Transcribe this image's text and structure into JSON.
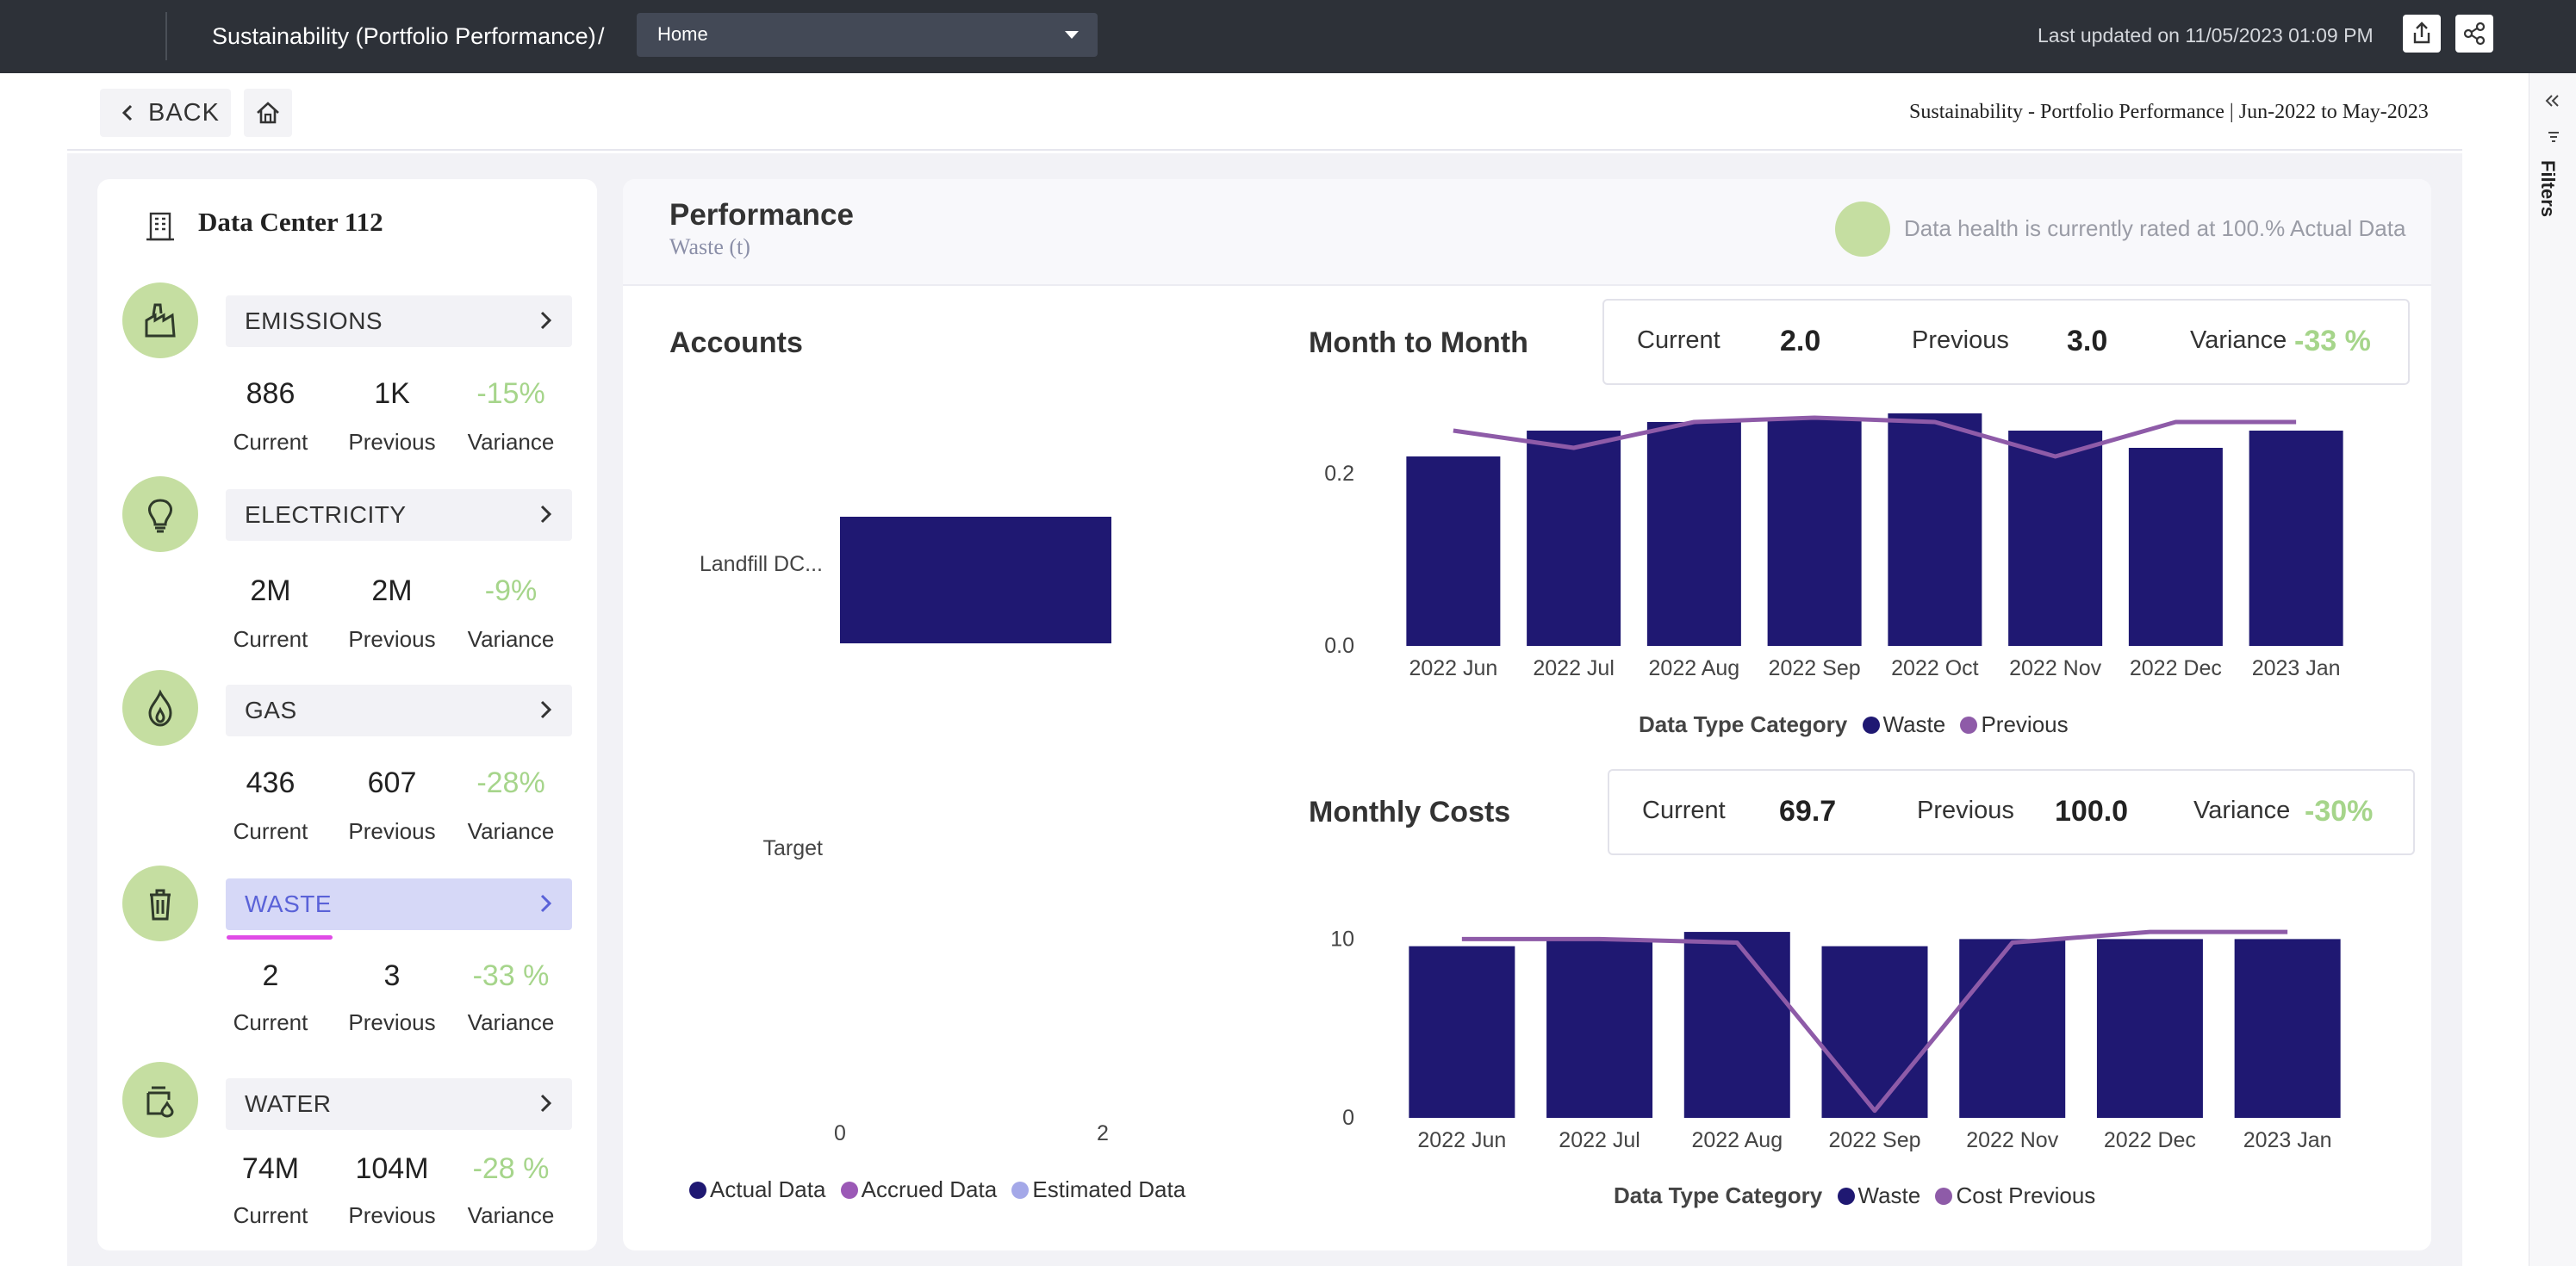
{
  "header": {
    "breadcrumb": "Sustainability (Portfolio Performance)",
    "separator": "/",
    "dropdown_value": "Home",
    "last_updated": "Last updated on 11/05/2023 01:09 PM"
  },
  "subheader": {
    "back_label": "BACK",
    "page_title": "Sustainability - Portfolio Performance | Jun-2022 to May-2023"
  },
  "filters_label": "Filters",
  "sidebar": {
    "site_name": "Data Center 112",
    "categories": [
      {
        "name": "EMISSIONS",
        "icon": "factory-icon",
        "current": "886",
        "previous": "1K",
        "variance": "-15%",
        "current_label": "Current",
        "previous_label": "Previous",
        "variance_label": "Variance"
      },
      {
        "name": "ELECTRICITY",
        "icon": "lightbulb-icon",
        "current": "2M",
        "previous": "2M",
        "variance": "-9%",
        "current_label": "Current",
        "previous_label": "Previous",
        "variance_label": "Variance"
      },
      {
        "name": "GAS",
        "icon": "gas-flame-icon",
        "current": "436",
        "previous": "607",
        "variance": "-28%",
        "current_label": "Current",
        "previous_label": "Previous",
        "variance_label": "Variance"
      },
      {
        "name": "WASTE",
        "icon": "trash-bin-icon",
        "current": "2",
        "previous": "3",
        "variance": "-33 %",
        "current_label": "Current",
        "previous_label": "Previous",
        "variance_label": "Variance",
        "active": true
      },
      {
        "name": "WATER",
        "icon": "water-icon",
        "current": "74M",
        "previous": "104M",
        "variance": "-28 %",
        "current_label": "Current",
        "previous_label": "Previous",
        "variance_label": "Variance"
      }
    ]
  },
  "performance": {
    "title": "Performance",
    "subtitle": "Waste (t)",
    "health_text": "Data health is currently rated at 100.% Actual Data",
    "accounts": {
      "title": "Accounts",
      "legend": [
        "Actual Data",
        "Accrued Data",
        "Estimated Data"
      ]
    },
    "month_to_month": {
      "title": "Month to Month",
      "current_label": "Current",
      "current": "2.0",
      "previous_label": "Previous",
      "previous": "3.0",
      "variance_label": "Variance",
      "variance": "-33 %",
      "legend_title": "Data Type Category",
      "legend": [
        "Waste",
        "Previous"
      ]
    },
    "monthly_costs": {
      "title": "Monthly Costs",
      "current_label": "Current",
      "current": "69.7",
      "previous_label": "Previous",
      "previous": "100.0",
      "variance_label": "Variance",
      "variance": "-30%",
      "legend_title": "Data Type Category",
      "legend": [
        "Waste",
        "Cost Previous"
      ]
    }
  },
  "colors": {
    "bar": "#1f1872",
    "line": "#8e5ba8",
    "accrued": "#9b59b6",
    "estimated": "#a4a8e8",
    "positive": "#a6d58b"
  },
  "chart_data": [
    {
      "type": "bar",
      "orientation": "horizontal",
      "categories": [
        "Landfill DC...",
        "Target"
      ],
      "values": [
        2,
        0
      ],
      "xlim": [
        0,
        2
      ],
      "xticks": [
        "0",
        "2"
      ],
      "series": [
        {
          "name": "Actual Data",
          "values": [
            2,
            0
          ]
        }
      ]
    },
    {
      "type": "bar",
      "categories": [
        "2022 Jun",
        "2022 Jul",
        "2022 Aug",
        "2022 Sep",
        "2022 Oct",
        "2022 Nov",
        "2022 Dec",
        "2023 Jan"
      ],
      "series": [
        {
          "name": "Waste",
          "type": "bar",
          "values": [
            0.22,
            0.25,
            0.26,
            0.265,
            0.27,
            0.25,
            0.23,
            0.25
          ]
        },
        {
          "name": "Previous",
          "type": "line",
          "values": [
            0.25,
            0.23,
            0.26,
            0.265,
            0.26,
            0.22,
            0.26,
            0.26
          ]
        }
      ],
      "ylim": [
        0,
        0.27
      ],
      "yticks": [
        "0.0",
        "0.2"
      ]
    },
    {
      "type": "bar",
      "categories": [
        "2022 Jun",
        "2022 Jul",
        "2022 Aug",
        "2022 Sep",
        "2022 Nov",
        "2022 Dec",
        "2023 Jan"
      ],
      "series": [
        {
          "name": "Waste",
          "type": "bar",
          "values": [
            9.6,
            10,
            10.4,
            9.6,
            10,
            10,
            10
          ]
        },
        {
          "name": "Cost Previous",
          "type": "line",
          "values": [
            10,
            10,
            9.8,
            0.4,
            9.8,
            10.4,
            10.4
          ]
        }
      ],
      "ylim": [
        0,
        10.5
      ],
      "yticks": [
        "0",
        "10"
      ]
    }
  ]
}
